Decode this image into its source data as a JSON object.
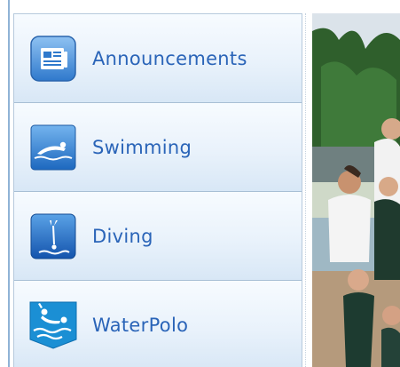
{
  "menu": {
    "items": [
      {
        "label": "Announcements",
        "icon": "newspaper-icon"
      },
      {
        "label": "Swimming",
        "icon": "swimmer-icon"
      },
      {
        "label": "Diving",
        "icon": "diver-icon"
      },
      {
        "label": "WaterPolo",
        "icon": "water-polo-icon"
      }
    ]
  },
  "colors": {
    "label": "#2a64b8",
    "icon_blue": "#1f6fc4",
    "item_gradient_top": "#f7fbff",
    "item_gradient_bottom": "#d8e7f6"
  }
}
